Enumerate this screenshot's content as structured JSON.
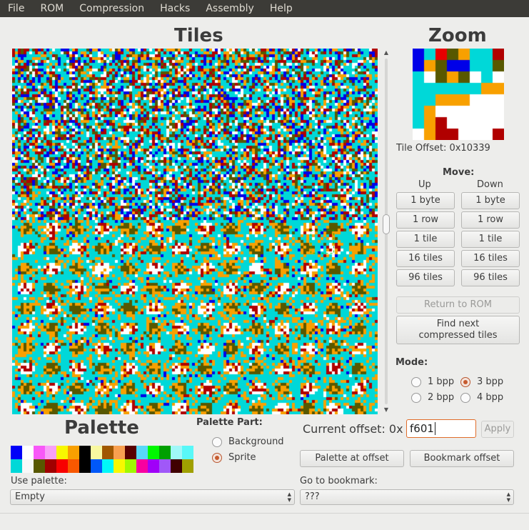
{
  "menu": [
    "File",
    "ROM",
    "Compression",
    "Hacks",
    "Assembly",
    "Help"
  ],
  "headings": {
    "tiles": "Tiles",
    "zoom": "Zoom",
    "palette": "Palette"
  },
  "tile_offset": "Tile Offset: 0x10339",
  "move": {
    "title": "Move:",
    "up": "Up",
    "down": "Down",
    "buttons": [
      "1 byte",
      "1 row",
      "1 tile",
      "16 tiles",
      "96 tiles"
    ]
  },
  "return_to_rom": "Return to ROM",
  "find_next": "Find next compressed tiles",
  "mode": {
    "title": "Mode:",
    "options": [
      "1 bpp",
      "3 bpp",
      "2 bpp",
      "4 bpp"
    ],
    "selected": "3 bpp"
  },
  "palette_part": {
    "title": "Palette Part:",
    "options": [
      "Background",
      "Sprite"
    ],
    "selected": "Sprite"
  },
  "offset": {
    "label": "Current offset: 0x",
    "value": "f601",
    "apply": "Apply"
  },
  "palette_at_offset": "Palette at offset",
  "bookmark_offset": "Bookmark offset",
  "use_palette": {
    "label": "Use palette:",
    "value": "Empty"
  },
  "go_to_bookmark": {
    "label": "Go to bookmark:",
    "value": "???"
  },
  "palette_colors": [
    [
      "#0000f8",
      "#ffffff",
      "#f858f8",
      "#f8a0f8",
      "#f8f800",
      "#f8a000",
      "#000000",
      "#f8f8a0",
      "#a05800",
      "#f8a050",
      "#580000",
      "#58d8f8",
      "#00f800",
      "#00a000",
      "#a0f8f8",
      "#58f8f8"
    ],
    [
      "#00d8d8",
      "#f8f8f8",
      "#585800",
      "#a00000",
      "#f80000",
      "#f85800",
      "#000000",
      "#0058f8",
      "#00f8f8",
      "#f8f800",
      "#a0f800",
      "#f800a0",
      "#a000f8",
      "#a058f8",
      "#400000",
      "#a0a000"
    ]
  ],
  "tile_colors": [
    "#00d8d8",
    "#00d8d8",
    "#00d8d8",
    "#f8a000",
    "#ffffff",
    "#b00000",
    "#0000e8",
    "#585800"
  ],
  "zoom_colors": [
    [
      "#0000e8",
      "#00d8d8",
      "#e80000",
      "#585800",
      "#f8a000",
      "#00d8d8",
      "#00d8d8",
      "#b00000"
    ],
    [
      "#0000e8",
      "#f8a000",
      "#585800",
      "#0000e8",
      "#0000e8",
      "#00d8d8",
      "#00d8d8",
      "#585800"
    ],
    [
      "#00d8d8",
      "#ffffff",
      "#585800",
      "#f8a000",
      "#585800",
      "#ffffff",
      "#00d8d8",
      "#ffffff"
    ],
    [
      "#00d8d8",
      "#00d8d8",
      "#00d8d8",
      "#00d8d8",
      "#00d8d8",
      "#00d8d8",
      "#f8a000",
      "#f8a000"
    ],
    [
      "#00d8d8",
      "#00d8d8",
      "#f8a000",
      "#f8a000",
      "#f8a000",
      "#ffffff",
      "#ffffff",
      "#ffffff"
    ],
    [
      "#00d8d8",
      "#f8a000",
      "#ffffff",
      "#ffffff",
      "#ffffff",
      "#ffffff",
      "#ffffff",
      "#ffffff"
    ],
    [
      "#00d8d8",
      "#f8a000",
      "#b00000",
      "#ffffff",
      "#ffffff",
      "#ffffff",
      "#ffffff",
      "#ffffff"
    ],
    [
      "#ffffff",
      "#f8a000",
      "#b00000",
      "#b00000",
      "#ffffff",
      "#ffffff",
      "#ffffff",
      "#b00000"
    ]
  ]
}
